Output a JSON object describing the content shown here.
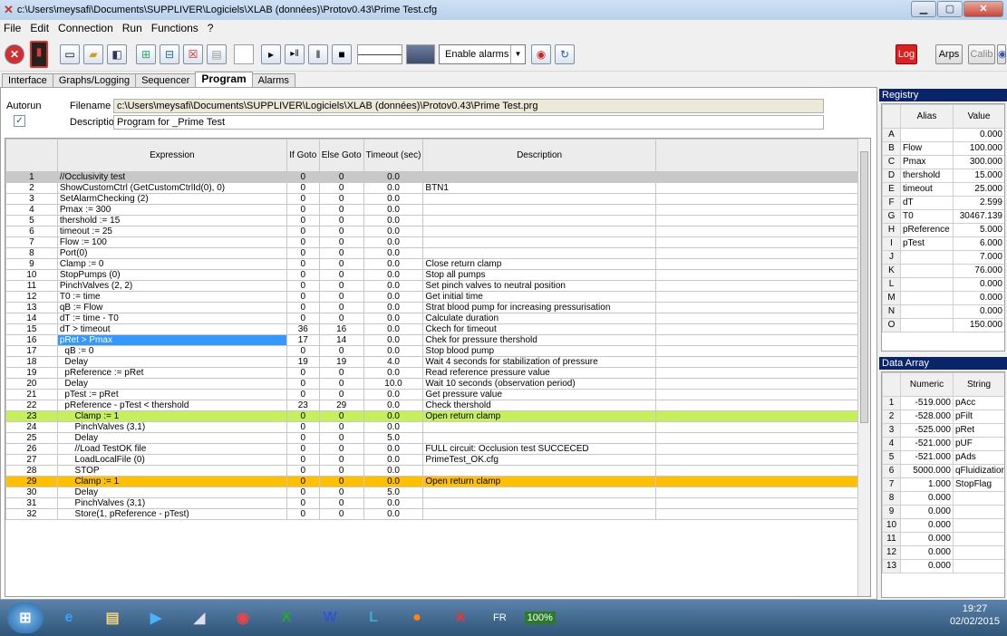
{
  "window": {
    "title": "c:\\Users\\meysafi\\Documents\\SUPPLIVER\\Logiciels\\XLAB (données)\\Protov0.43\\Prime Test.cfg"
  },
  "menu": [
    "File",
    "Edit",
    "Connection",
    "Run",
    "Functions",
    "?"
  ],
  "toolbar": {
    "alarm_select": "Enable alarms",
    "log_label": "Log",
    "arps_label": "Arps",
    "calib_label": "Calib"
  },
  "tabs": [
    "Interface",
    "Graphs/Logging",
    "Sequencer",
    "Program",
    "Alarms"
  ],
  "active_tab": "Program",
  "program": {
    "autorun_label": "Autorun",
    "filename_label": "Filename",
    "filename_value": "c:\\Users\\meysafi\\Documents\\SUPPLIVER\\Logiciels\\XLAB (données)\\Protov0.43\\Prime Test.prg",
    "description_label": "Description",
    "description_value": "Program for _Prime Test",
    "columns": [
      "Expression",
      "If Goto",
      "Else Goto",
      "Timeout (sec)",
      "Description"
    ],
    "rows": [
      [
        "1",
        "//Occlusivity test",
        "0",
        "0",
        "0.0",
        ""
      ],
      [
        "2",
        "ShowCustomCtrl (GetCustomCtrlId(0), 0)",
        "0",
        "0",
        "0.0",
        "BTN1"
      ],
      [
        "3",
        "SetAlarmChecking (2)",
        "0",
        "0",
        "0.0",
        ""
      ],
      [
        "4",
        "Pmax := 300",
        "0",
        "0",
        "0.0",
        ""
      ],
      [
        "5",
        "thershold := 15",
        "0",
        "0",
        "0.0",
        ""
      ],
      [
        "6",
        "timeout := 25",
        "0",
        "0",
        "0.0",
        ""
      ],
      [
        "7",
        "Flow := 100",
        "0",
        "0",
        "0.0",
        ""
      ],
      [
        "8",
        "Port(0)",
        "0",
        "0",
        "0.0",
        ""
      ],
      [
        "9",
        "Clamp := 0",
        "0",
        "0",
        "0.0",
        "Close return clamp"
      ],
      [
        "10",
        "StopPumps (0)",
        "0",
        "0",
        "0.0",
        "Stop all pumps"
      ],
      [
        "11",
        "PinchValves (2, 2)",
        "0",
        "0",
        "0.0",
        "Set pinch valves to neutral position"
      ],
      [
        "12",
        "T0 := time",
        "0",
        "0",
        "0.0",
        "Get initial time"
      ],
      [
        "13",
        "qB := Flow",
        "0",
        "0",
        "0.0",
        "Strat blood pump for increasing pressurisation"
      ],
      [
        "14",
        "dT := time - T0",
        "0",
        "0",
        "0.0",
        "Calculate duration"
      ],
      [
        "15",
        "dT > timeout",
        "36",
        "16",
        "0.0",
        "Ckech for timeout"
      ],
      [
        "16",
        "pRet > Pmax",
        "17",
        "14",
        "0.0",
        "Chek for pressure thershold"
      ],
      [
        "17",
        "  qB := 0",
        "0",
        "0",
        "0.0",
        "Stop  blood pump"
      ],
      [
        "18",
        "  Delay",
        "19",
        "19",
        "4.0",
        "Wait 4 seconds for stabilization of pressure"
      ],
      [
        "19",
        "  pReference := pRet",
        "0",
        "0",
        "0.0",
        "Read reference pressure value"
      ],
      [
        "20",
        "  Delay",
        "0",
        "0",
        "10.0",
        "Wait 10 seconds (observation period)"
      ],
      [
        "21",
        "  pTest := pRet",
        "0",
        "0",
        "0.0",
        "Get pressure value"
      ],
      [
        "22",
        "  pReference - pTest < thershold",
        "23",
        "29",
        "0.0",
        "Check thershold"
      ],
      [
        "23",
        "      Clamp := 1",
        "0",
        "0",
        "0.0",
        "Open return clamp"
      ],
      [
        "24",
        "      PinchValves (3,1)",
        "0",
        "0",
        "0.0",
        ""
      ],
      [
        "25",
        "      Delay",
        "0",
        "0",
        "5.0",
        ""
      ],
      [
        "26",
        "      //Load TestOK file",
        "0",
        "0",
        "0.0",
        "FULL circuit: Occlusion test  SUCCECED"
      ],
      [
        "27",
        "      LoadLocalFile (0)",
        "0",
        "0",
        "0.0",
        "PrimeTest_OK.cfg"
      ],
      [
        "28",
        "      STOP",
        "0",
        "0",
        "0.0",
        ""
      ],
      [
        "29",
        "      Clamp := 1",
        "0",
        "0",
        "0.0",
        "Open return clamp"
      ],
      [
        "30",
        "      Delay",
        "0",
        "0",
        "5.0",
        ""
      ],
      [
        "31",
        "      PinchValves (3,1)",
        "0",
        "0",
        "0.0",
        ""
      ],
      [
        "32",
        "      Store(1, pReference - pTest)",
        "0",
        "0",
        "0.0",
        ""
      ]
    ],
    "row_styles": {
      "1": "gray",
      "16": "blue",
      "23": "green",
      "29": "orange"
    }
  },
  "registry": {
    "title": "Registry",
    "columns": [
      "Alias",
      "Value"
    ],
    "rows": [
      [
        "A",
        "",
        "0.000"
      ],
      [
        "B",
        "Flow",
        "100.000"
      ],
      [
        "C",
        "Pmax",
        "300.000"
      ],
      [
        "D",
        "thershold",
        "15.000"
      ],
      [
        "E",
        "timeout",
        "25.000"
      ],
      [
        "F",
        "dT",
        "2.599"
      ],
      [
        "G",
        "T0",
        "30467.139"
      ],
      [
        "H",
        "pReference",
        "5.000"
      ],
      [
        "I",
        "pTest",
        "6.000"
      ],
      [
        "J",
        "",
        "7.000"
      ],
      [
        "K",
        "",
        "76.000"
      ],
      [
        "L",
        "",
        "0.000"
      ],
      [
        "M",
        "",
        "0.000"
      ],
      [
        "N",
        "",
        "0.000"
      ],
      [
        "O",
        "",
        "150.000"
      ]
    ]
  },
  "data_array": {
    "title": "Data Array",
    "columns": [
      "Numeric",
      "String"
    ],
    "rows": [
      [
        "1",
        "-519.000",
        "pAcc"
      ],
      [
        "2",
        "-528.000",
        "pFilt"
      ],
      [
        "3",
        "-525.000",
        "pRet"
      ],
      [
        "4",
        "-521.000",
        "pUF"
      ],
      [
        "5",
        "-521.000",
        "pAds"
      ],
      [
        "6",
        "5000.000",
        "qFluidization"
      ],
      [
        "7",
        "1.000",
        "StopFlag"
      ],
      [
        "8",
        "0.000",
        ""
      ],
      [
        "9",
        "0.000",
        ""
      ],
      [
        "10",
        "0.000",
        ""
      ],
      [
        "11",
        "0.000",
        ""
      ],
      [
        "12",
        "0.000",
        ""
      ],
      [
        "13",
        "0.000",
        ""
      ]
    ]
  },
  "taskbar": {
    "lang": "FR",
    "zoom": "100%",
    "time": "19:27",
    "date": "02/02/2015"
  },
  "colors": {
    "selected_row": "#3399ff",
    "green_row": "#c5f05c",
    "orange_row": "#ffc000",
    "registry_header": "#0a246a",
    "log_button": "#e02020"
  }
}
